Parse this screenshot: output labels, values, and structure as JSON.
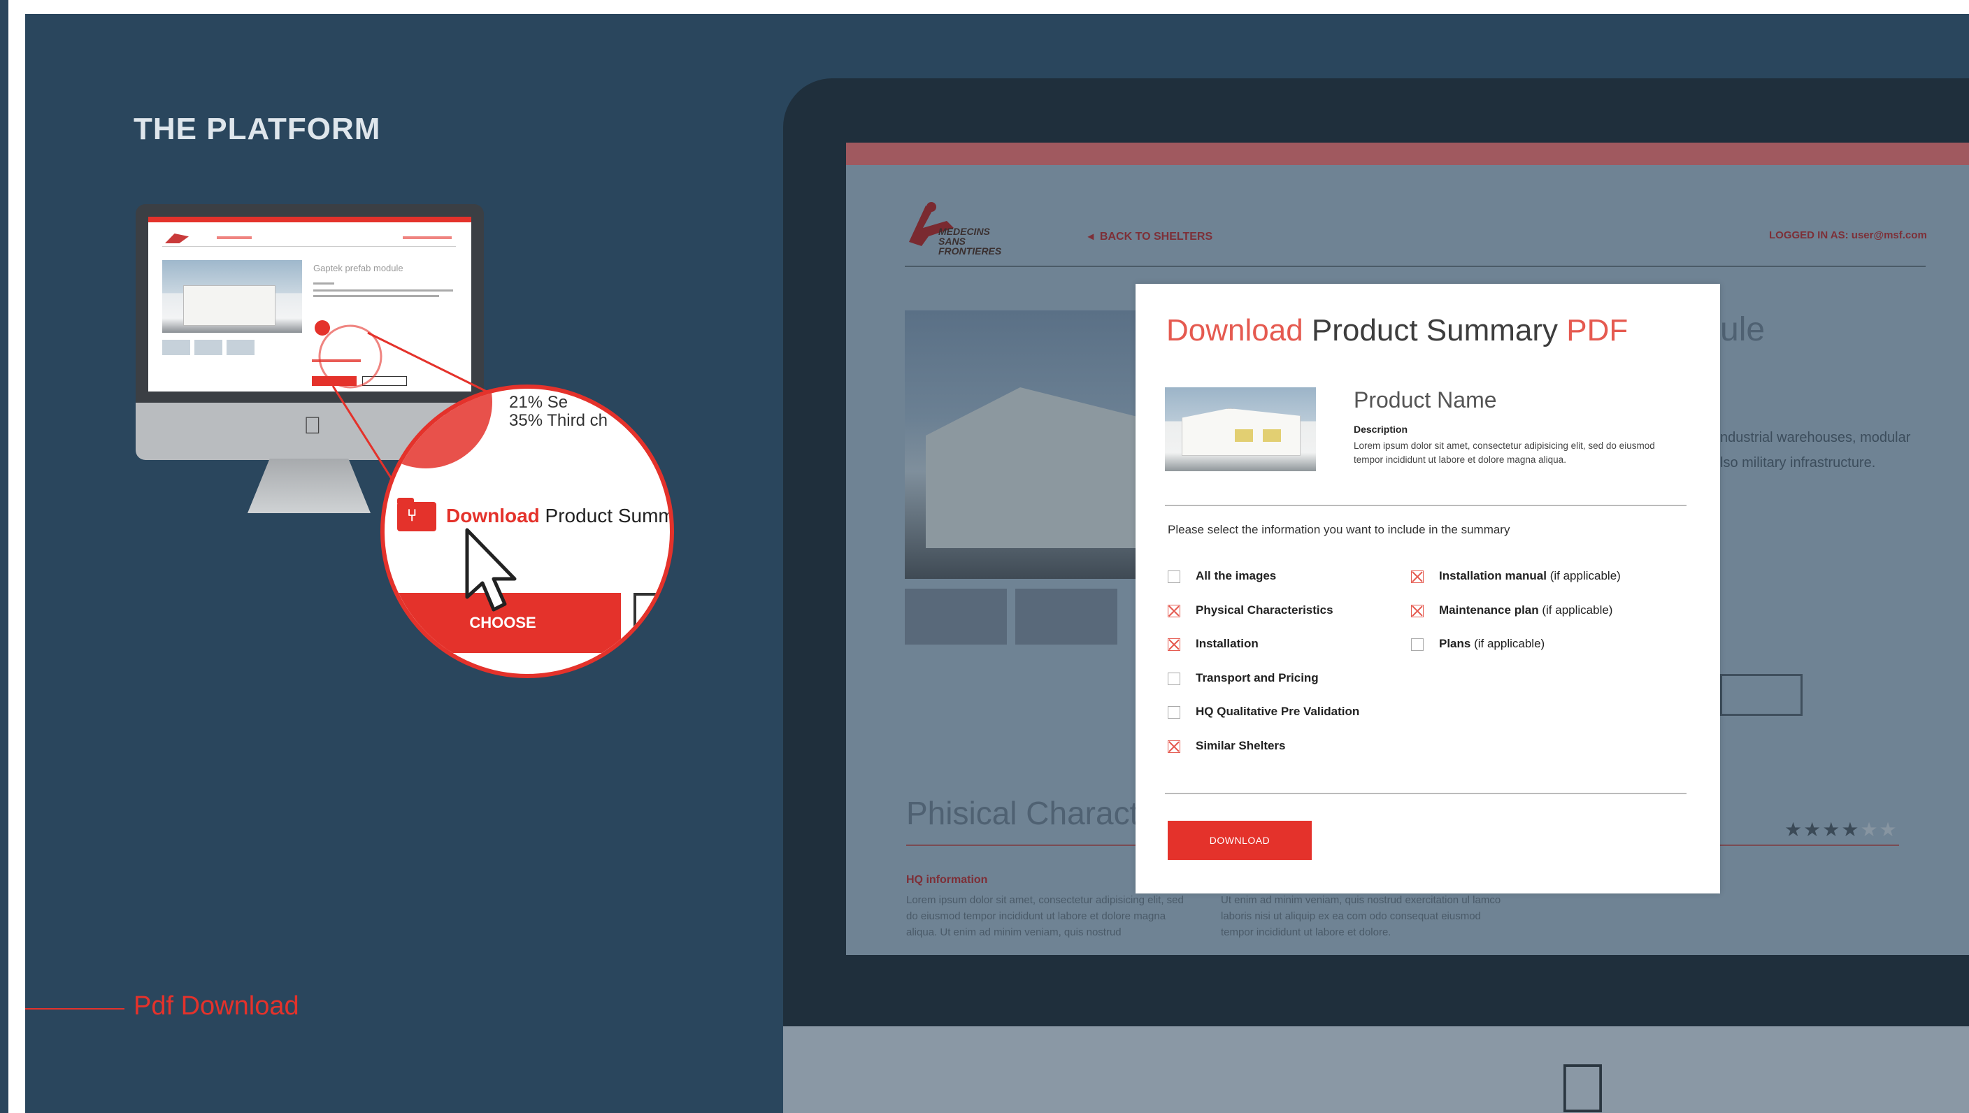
{
  "slide": {
    "section_title": "THE PLATFORM",
    "caption": "Pdf Download"
  },
  "magnifier": {
    "stat_line_1": "21% Se",
    "stat_line_2": "35% Third ch",
    "download_word": "Download",
    "download_rest": " Product Summ",
    "choose_label": "CHOOSE"
  },
  "background_page": {
    "logo_text": "MEDECINS SANS FRONTIERES",
    "back_link": "BACK TO SHELTERS",
    "logged_in": "LOGGED IN AS: user@msf.com",
    "title_fragment": "ule",
    "desc_fragment_1": "ndustrial warehouses, modular",
    "desc_fragment_2": "lso military infrastructure.",
    "section_heading": "Phisical Characte",
    "hq_label": "HQ information",
    "para_left": "Lorem ipsum dolor sit amet, consectetur adipisicing elit, sed do eiusmod tempor incididunt ut labore et dolore magna aliqua. Ut enim ad minim veniam, quis nostrud",
    "para_right": "Ut enim ad minim veniam, quis nostrud exercitation ul lamco laboris nisi ut aliquip ex ea com odo consequat eiusmod tempor incididunt ut labore et dolore.",
    "rating": 4,
    "rating_max": 6
  },
  "modal": {
    "title_part1": "Download",
    "title_part2": " Product Summary ",
    "title_part3": "PDF",
    "product_name": "Product Name",
    "description_heading": "Description",
    "description_text": "Lorem ipsum dolor sit amet, consectetur adipisicing elit, sed do eiusmod tempor incididunt ut labore et dolore magna aliqua.",
    "instruction": "Please select the information you want to include in the summary",
    "options_left": [
      {
        "label": "All the images",
        "suffix": "",
        "checked": false
      },
      {
        "label": "Physical Characteristics",
        "suffix": "",
        "checked": true
      },
      {
        "label": "Installation",
        "suffix": "",
        "checked": true
      },
      {
        "label": "Transport and Pricing",
        "suffix": "",
        "checked": false
      },
      {
        "label": "HQ Qualitative Pre Validation",
        "suffix": "",
        "checked": false
      },
      {
        "label": "Similar Shelters",
        "suffix": "",
        "checked": true
      }
    ],
    "options_right": [
      {
        "label": "Installation manual",
        "suffix": " (if applicable)",
        "checked": true
      },
      {
        "label": "Maintenance plan",
        "suffix": " (if applicable)",
        "checked": true
      },
      {
        "label": "Plans",
        "suffix": " (if applicable)",
        "checked": false
      }
    ],
    "download_button": "DOWNLOAD"
  },
  "colors": {
    "accent": "#e4322b",
    "background": "#2a465d"
  }
}
